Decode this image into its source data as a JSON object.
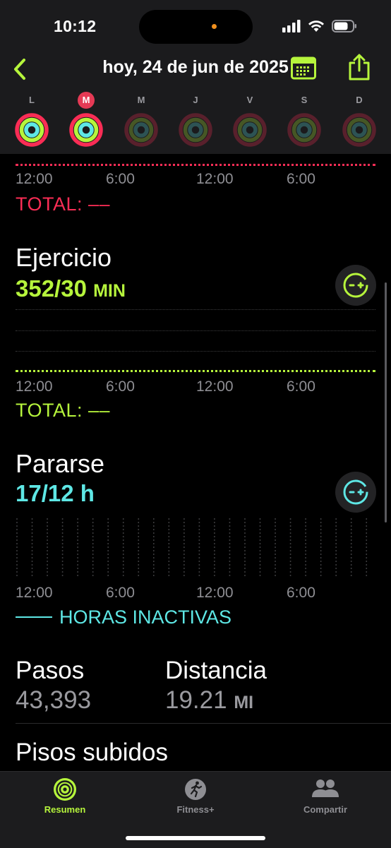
{
  "status": {
    "time": "10:12"
  },
  "header": {
    "title": "hoy, 24 de jun de 2025"
  },
  "week": {
    "days": [
      {
        "label": "L",
        "selected": false,
        "active": true
      },
      {
        "label": "M",
        "selected": true,
        "active": true
      },
      {
        "label": "M",
        "selected": false,
        "active": false
      },
      {
        "label": "J",
        "selected": false,
        "active": false
      },
      {
        "label": "V",
        "selected": false,
        "active": false
      },
      {
        "label": "S",
        "selected": false,
        "active": false
      },
      {
        "label": "D",
        "selected": false,
        "active": false
      }
    ]
  },
  "axis_labels": [
    "12:00",
    "6:00",
    "12:00",
    "6:00"
  ],
  "move": {
    "total_label": "TOTAL: ––"
  },
  "exercise": {
    "title": "Ejercicio",
    "value": "352/30",
    "unit": "MIN",
    "total_label": "TOTAL: ––"
  },
  "stand": {
    "title": "Pararse",
    "value": "17/12 h",
    "legend": "HORAS INACTIVAS"
  },
  "steps": {
    "label": "Pasos",
    "value": "43,393"
  },
  "distance": {
    "label": "Distancia",
    "value": "19.21",
    "unit": "MI"
  },
  "floors": {
    "label": "Pisos subidos"
  },
  "tabs": [
    {
      "label": "Resumen",
      "active": true
    },
    {
      "label": "Fitness+",
      "active": false
    },
    {
      "label": "Compartir",
      "active": false
    }
  ],
  "colors": {
    "move": "#fa2d55",
    "exercise": "#b6f53c",
    "stand": "#5ee7e5",
    "accent": "#b6f53c",
    "tab_inactive": "#8e8e93"
  }
}
